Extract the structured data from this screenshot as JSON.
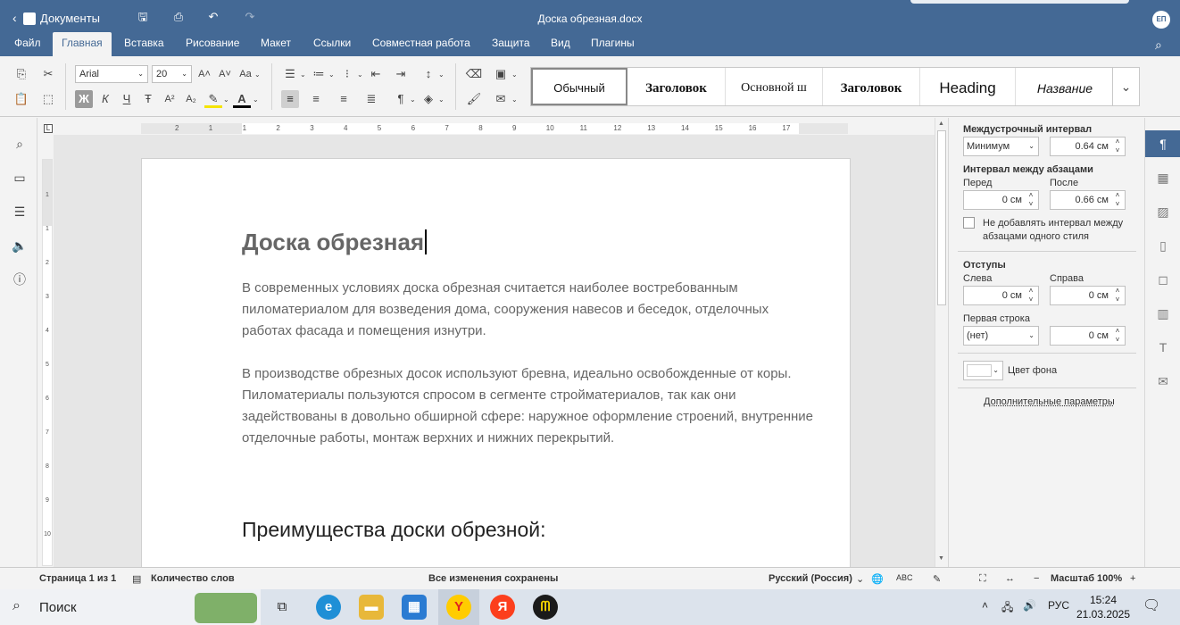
{
  "titlebar": {
    "back_label": "Документы",
    "doc_title": "Доска обрезная.docx",
    "avatar": "ЕП"
  },
  "menu": {
    "tabs": [
      "Файл",
      "Главная",
      "Вставка",
      "Рисование",
      "Макет",
      "Ссылки",
      "Совместная работа",
      "Защита",
      "Вид",
      "Плагины"
    ],
    "active": "Главная"
  },
  "ribbon": {
    "font_name": "Arial",
    "font_size": "20",
    "bold_label": "Ж",
    "italic_label": "К",
    "underline_label": "Ч",
    "strike_label": "Ŧ",
    "styles": [
      "Обычный",
      "Заголовок",
      "Основной ш",
      "Заголовок",
      "Heading",
      "Название"
    ]
  },
  "document": {
    "title": "Доска обрезная",
    "paragraphs": [
      "В современных условиях доска обрезная считается наиболее востребованным пиломатериалом для возведения дома, сооружения навесов и беседок, отделочных работах фасада и помещения изнутри.",
      "В производстве обрезных досок используют бревна, идеально освобожденные от коры. Пиломатериалы пользуются спросом в сегменте стройматериалов, так как они задействованы в довольно обширной сфере: наружное оформление строений, внутренние отделочные работы, монтаж верхних и нижних перекрытий."
    ],
    "heading2": "Преимущества доски обрезной:"
  },
  "ruler": {
    "h_labels": [
      "2",
      "1",
      "1",
      "2",
      "3",
      "4",
      "5",
      "6",
      "7",
      "8",
      "9",
      "10",
      "11",
      "12",
      "13",
      "14",
      "15",
      "16",
      "17"
    ],
    "v_labels": [
      "1",
      "1",
      "2",
      "3",
      "4",
      "5",
      "6",
      "7",
      "8",
      "9",
      "10"
    ]
  },
  "paragraph_panel": {
    "line_spacing_title": "Междустрочный интервал",
    "line_spacing_mode": "Минимум",
    "line_spacing_value": "0.64 см",
    "para_spacing_title": "Интервал между абзацами",
    "before_label": "Перед",
    "before_value": "0 см",
    "after_label": "После",
    "after_value": "0.66 см",
    "no_space_same_style": "Не добавлять интервал между абзацами одного стиля",
    "indents_title": "Отступы",
    "left_label": "Слева",
    "left_value": "0 см",
    "right_label": "Справа",
    "right_value": "0 см",
    "first_line_label": "Первая строка",
    "first_line_mode": "(нет)",
    "first_line_value": "0 см",
    "bg_color_label": "Цвет фона",
    "advanced_link": "Дополнительные параметры"
  },
  "statusbar": {
    "page": "Страница 1 из 1",
    "word_count": "Количество слов",
    "saved": "Все изменения сохранены",
    "language": "Русский (Россия)",
    "zoom": "Масштаб 100%"
  },
  "taskbar": {
    "search_placeholder": "Поиск",
    "lang": "РУС",
    "time": "15:24",
    "date": "21.03.2025"
  },
  "colors": {
    "accent": "#446995",
    "titlebar": "#446995",
    "workspace": "#e6e6e6"
  }
}
